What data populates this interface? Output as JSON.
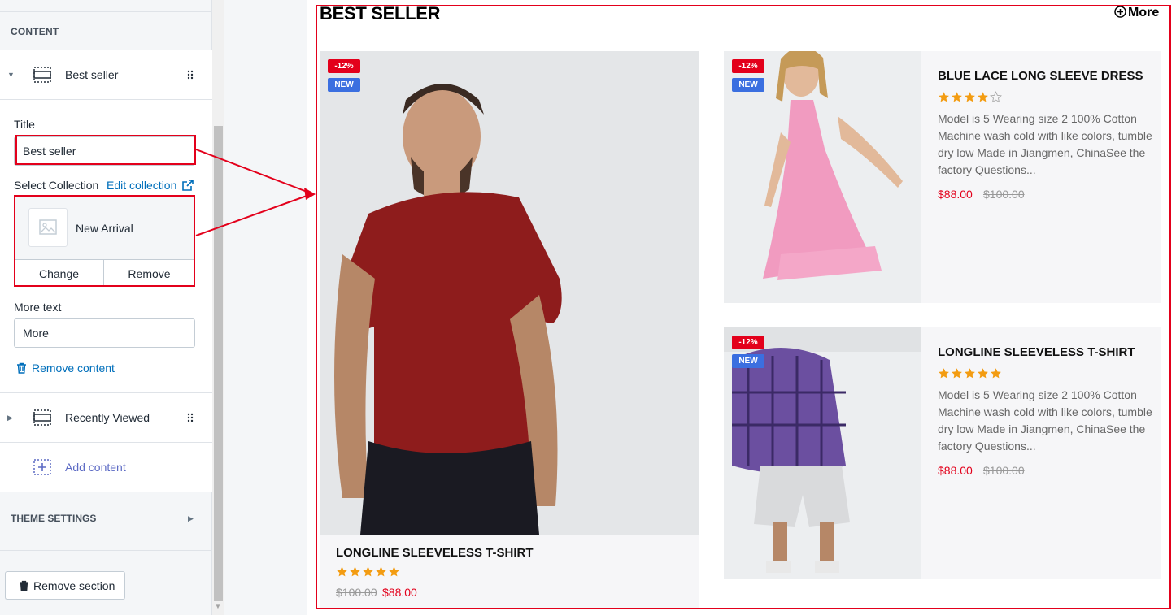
{
  "sidebar": {
    "content_heading": "CONTENT",
    "sections": [
      {
        "label": "Best seller",
        "icon": "section-icon"
      },
      {
        "label": "Recently Viewed",
        "icon": "section-icon"
      }
    ],
    "title_label": "Title",
    "title_value": "Best seller",
    "select_collection_label": "Select Collection",
    "edit_collection_link": "Edit collection",
    "collection_name": "New Arrival",
    "change_button": "Change",
    "remove_button": "Remove",
    "more_text_label": "More text",
    "more_text_value": "More",
    "remove_content_link": "Remove content",
    "add_content_label": "Add content",
    "theme_settings_heading": "THEME SETTINGS",
    "remove_section_button": "Remove section"
  },
  "preview": {
    "section_title": "BEST SELLER",
    "more_link": "More",
    "featured_product": {
      "name": "LONGLINE SLEEVELESS T-SHIRT",
      "rating": 5,
      "price_old": "$100.00",
      "price_new": "$88.00",
      "badge_sale": "-12%",
      "badge_new": "NEW"
    },
    "products": [
      {
        "name": "BLUE LACE LONG SLEEVE DRESS",
        "rating": 4,
        "description": "Model is 5 Wearing size 2 100% Cotton Machine wash cold with like colors, tumble dry low Made in Jiangmen, ChinaSee the factory Questions...",
        "price_new": "$88.00",
        "price_old": "$100.00",
        "badge_sale": "-12%",
        "badge_new": "NEW"
      },
      {
        "name": "LONGLINE SLEEVELESS T-SHIRT",
        "rating": 5,
        "description": "Model is 5 Wearing size 2 100% Cotton Machine wash cold with like colors, tumble dry low Made in Jiangmen, ChinaSee the factory Questions...",
        "price_new": "$88.00",
        "price_old": "$100.00",
        "badge_sale": "-12%",
        "badge_new": "NEW"
      }
    ]
  },
  "colors": {
    "highlight": "#e3001b",
    "star": "#f39c12",
    "link": "#006fbb",
    "sale_badge": "#e3001b",
    "new_badge": "#3b6fe0"
  }
}
